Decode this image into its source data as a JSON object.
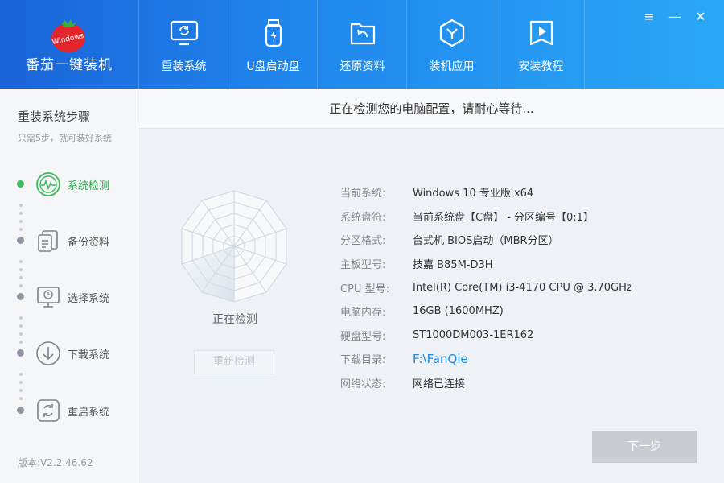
{
  "app": {
    "name": "番茄一键装机",
    "logo_text": "Windows"
  },
  "nav": {
    "items": [
      {
        "label": "重装系统",
        "icon": "monitor-refresh-icon"
      },
      {
        "label": "U盘启动盘",
        "icon": "usb-drive-icon"
      },
      {
        "label": "还原资料",
        "icon": "restore-folder-icon"
      },
      {
        "label": "装机应用",
        "icon": "app-hexagon-icon"
      },
      {
        "label": "安装教程",
        "icon": "video-play-icon"
      }
    ]
  },
  "window_controls": {
    "menu": "≡",
    "minimize": "—",
    "close": "✕"
  },
  "sidebar": {
    "title": "重装系统步骤",
    "subtitle": "只需5步，就可装好系统",
    "steps": [
      {
        "label": "系统检测",
        "icon": "heartbeat-icon",
        "active": true
      },
      {
        "label": "备份资料",
        "icon": "document-copy-icon",
        "active": false
      },
      {
        "label": "选择系统",
        "icon": "computer-icon",
        "active": false
      },
      {
        "label": "下载系统",
        "icon": "download-icon",
        "active": false
      },
      {
        "label": "重启系统",
        "icon": "restart-icon",
        "active": false
      }
    ],
    "version": "版本:V2.2.46.62"
  },
  "main": {
    "status_title": "正在检测您的电脑配置，请耐心等待...",
    "detect_label": "正在检测",
    "redetect_button": "重新检测",
    "next_button": "下一步",
    "info": [
      {
        "label": "当前系统:",
        "value": "Windows 10 专业版 x64"
      },
      {
        "label": "系统盘符:",
        "value": "当前系统盘【C盘】 - 分区编号【0:1】"
      },
      {
        "label": "分区格式:",
        "value": "台式机 BIOS启动（MBR分区）"
      },
      {
        "label": "主板型号:",
        "value": "技嘉 B85M-D3H"
      },
      {
        "label": "CPU 型号:",
        "value": "Intel(R) Core(TM) i3-4170 CPU @ 3.70GHz"
      },
      {
        "label": "电脑内存:",
        "value": "16GB (1600MHZ)"
      },
      {
        "label": "硬盘型号:",
        "value": "ST1000DM003-1ER162"
      },
      {
        "label": "下载目录:",
        "value": "F:\\FanQie"
      },
      {
        "label": "网络状态:",
        "value": "网络已连接"
      }
    ]
  },
  "colors": {
    "header_start": "#1a63d8",
    "header_end": "#2aa7f6",
    "active_green": "#3cba5c",
    "link_blue": "#1e88e5"
  }
}
